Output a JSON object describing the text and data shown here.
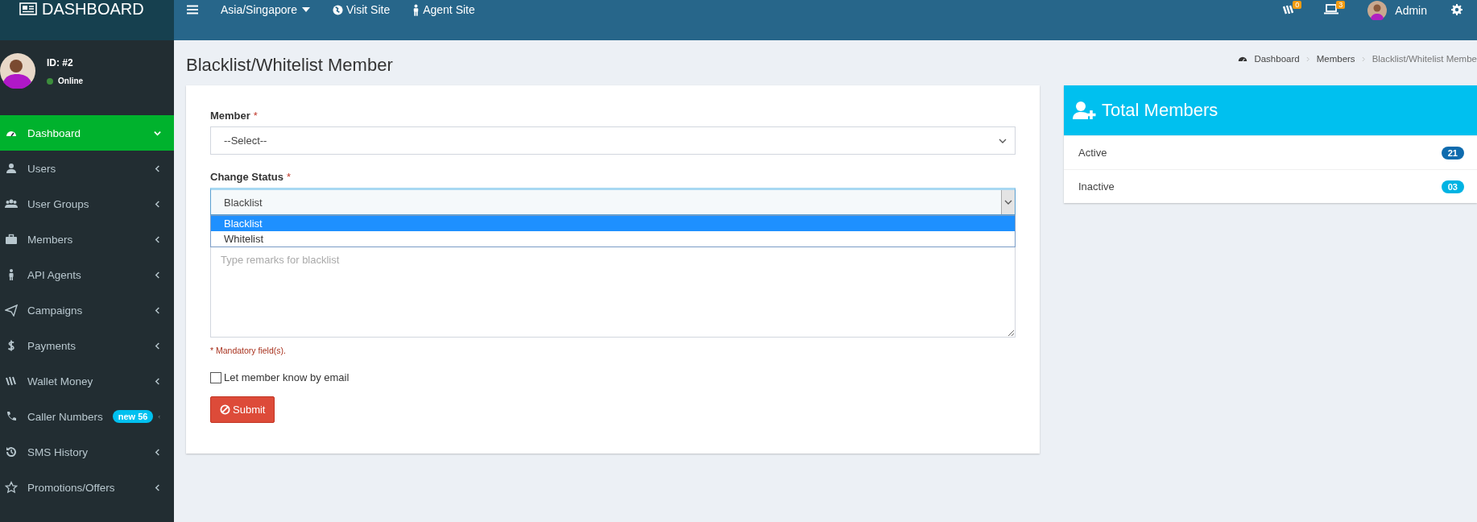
{
  "topbar": {
    "logo": "DASHBOARD",
    "timezone": "Asia/Singapore",
    "links": [
      "Visit Site",
      "Agent Site"
    ],
    "notifications": [
      {
        "count": "0"
      },
      {
        "count": "3"
      }
    ],
    "user": "Admin"
  },
  "user_panel": {
    "id": "ID: #2",
    "status": "Online",
    "online": true
  },
  "sidebar": {
    "items": [
      {
        "label": "Dashboard",
        "selected": true
      },
      {
        "label": "Users",
        "selected": false
      },
      {
        "label": "User Groups",
        "selected": false
      },
      {
        "label": "Members",
        "selected": false
      },
      {
        "label": "API Agents",
        "selected": false
      },
      {
        "label": "Campaigns",
        "selected": false
      },
      {
        "label": "Payments",
        "selected": false
      },
      {
        "label": "Wallet Money",
        "selected": false
      },
      {
        "label": "Caller Numbers",
        "selected": false,
        "badge": "new 56"
      },
      {
        "label": "SMS History",
        "selected": false
      },
      {
        "label": "Promotions/Offers",
        "selected": false
      }
    ]
  },
  "page": {
    "title": "Blacklist/Whitelist Member",
    "breadcrumb": [
      "Dashboard",
      "Members",
      "Blacklist/Whitelist Membe"
    ]
  },
  "form": {
    "member": {
      "label": "Member",
      "required": "*",
      "value": "--Select--"
    },
    "status": {
      "label": "Change Status",
      "required": "*",
      "value": "Blacklist",
      "expanded": true,
      "options": [
        {
          "label": "Blacklist",
          "selected": true
        },
        {
          "label": "Whitelist",
          "selected": false
        }
      ]
    },
    "remarks": {
      "placeholder": "Type remarks for blacklist"
    },
    "note": "* Mandatory field(s).",
    "email_checkbox": {
      "label": "Let member know by email",
      "checked": false
    },
    "submit": "Submit"
  },
  "total_members": {
    "title": "Total Members",
    "rows": [
      {
        "label": "Active",
        "count": "21",
        "color": "#0e6bae"
      },
      {
        "label": "Inactive",
        "count": "03",
        "color": "#00b3e3"
      }
    ]
  }
}
